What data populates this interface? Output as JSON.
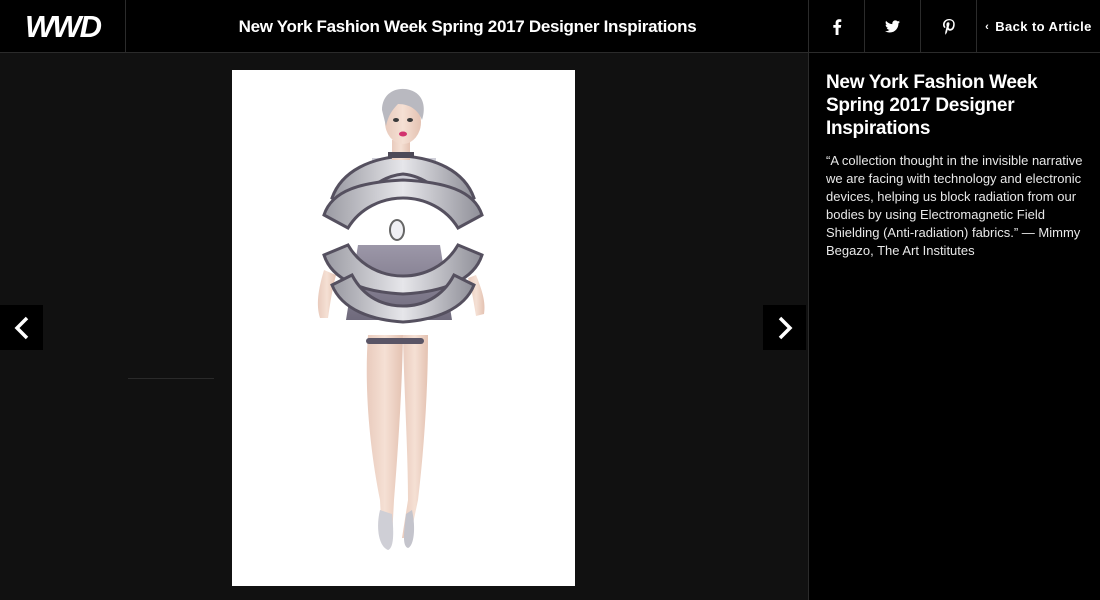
{
  "header": {
    "logo_text": "WWD",
    "title": "New York Fashion Week Spring 2017 Designer Inspirations",
    "social": [
      {
        "name": "facebook-icon",
        "glyph": "f"
      },
      {
        "name": "twitter-icon",
        "glyph": "twitter"
      },
      {
        "name": "pinterest-icon",
        "glyph": "pinterest"
      }
    ],
    "back_label": "Back to Article",
    "back_icon": "chevron-left-icon"
  },
  "gallery": {
    "prev_icon": "chevron-left-icon",
    "next_icon": "chevron-right-icon",
    "image": "fashion-illustration: model in silver structured mini dress with striped ribs"
  },
  "sidebar": {
    "title": "New York Fashion Week Spring 2017 Designer Inspirations",
    "caption": "“A collection thought in the invisible narrative we are facing with technology and electronic devices, helping us block radiation from our bodies by using Electromagnetic Field Shielding (Anti-radiation) fabrics.” — Mimmy Begazo, The Art Institutes"
  },
  "colors": {
    "background": "#111111",
    "bar": "#000000",
    "text": "#ffffff",
    "divider": "#2b2b2b"
  }
}
